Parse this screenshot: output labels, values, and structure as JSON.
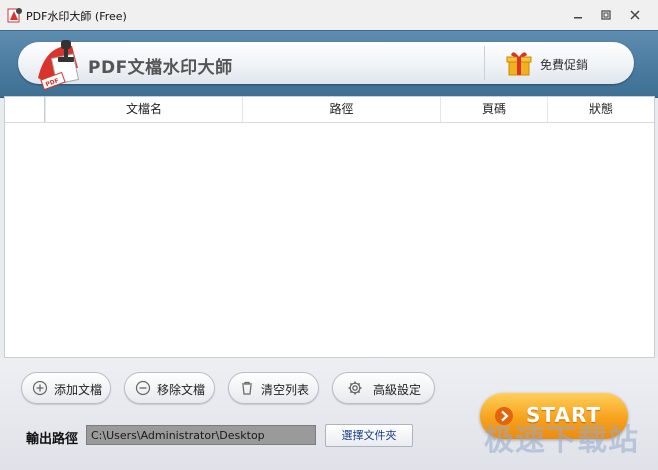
{
  "window": {
    "title": "PDF水印大師 (Free)",
    "controls": [
      "minimize",
      "restore",
      "close"
    ]
  },
  "banner": {
    "title": "PDF文檔水印大師",
    "promo_label": "免費促銷",
    "logo_badge": "PDF"
  },
  "table": {
    "columns": [
      "文檔名",
      "路徑",
      "頁碼",
      "狀態"
    ],
    "rows": []
  },
  "toolbar": {
    "add_label": "添加文檔",
    "remove_label": "移除文檔",
    "clear_label": "清空列表",
    "settings_label": "高級設定"
  },
  "output": {
    "label": "輸出路徑",
    "path": "C:\\Users\\Administrator\\Desktop",
    "choose_label": "選擇文件夾"
  },
  "start_label": "START",
  "watermark_text": "极速下载站",
  "colors": {
    "banner": "#4a7ca2",
    "start": "#f7a21d",
    "path_field": "#9a9a9a"
  }
}
